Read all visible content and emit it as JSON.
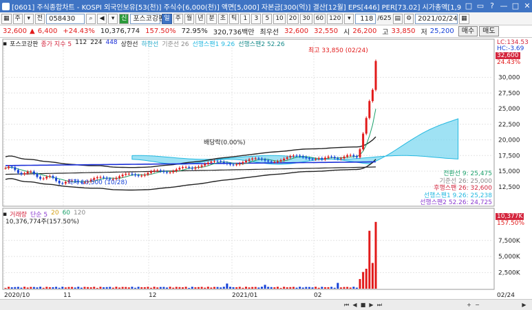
{
  "window": {
    "title": "[0601] 주식종합차트 - KOSPI 외국인보유[53(천)] 주식수[6,000(천)] 액면[5,000] 자본금[300(억)] 결산[12월] EPS[446] PER[73.02] 시가총액[1,956억]",
    "buttons": [
      "□",
      "▭",
      "?",
      "—",
      "□",
      "✕"
    ]
  },
  "toolbar": {
    "market_label": "주",
    "view_label": "전",
    "code": "058430",
    "name": "포스코강판",
    "periods": [
      "일",
      "주",
      "월",
      "년",
      "분",
      "초",
      "틱"
    ],
    "selected_period": "일",
    "minutes": [
      "1",
      "3",
      "5",
      "10",
      "20",
      "30",
      "60",
      "120"
    ],
    "count": "118",
    "count_total": "/625",
    "date": "2021/02/24"
  },
  "info": {
    "price": "32,600",
    "change": "6,400",
    "change_pct": "+24.43%",
    "volume": "10,376,774",
    "volume_pct": "157.50%",
    "ratio": "72.95%",
    "amount": "320,736백만",
    "limit_label": "최우선",
    "ask": "32,600",
    "bid": "32,550",
    "open_label": "시",
    "open": "26,200",
    "high_label": "고",
    "high": "33,850",
    "low_label": "저",
    "low": "25,200",
    "buy": "매수",
    "sell": "매도"
  },
  "price_legend": {
    "name": "포스코강판",
    "items": [
      {
        "label": "종가 지수 5",
        "color": "#d4263e"
      },
      {
        "label": "112",
        "color": "#222222"
      },
      {
        "label": "224",
        "color": "#222222"
      },
      {
        "label": "448",
        "color": "#1b2fd8"
      },
      {
        "label": "상한선",
        "color": "#222222"
      },
      {
        "label": "하한선",
        "color": "#22a9c9"
      },
      {
        "label": "기준선 26",
        "color": "#888888"
      },
      {
        "label": "선행스팬1 9.26",
        "color": "#22b8e0"
      },
      {
        "label": "선행스팬2 52.26",
        "color": "#168a8a"
      }
    ]
  },
  "annotations": {
    "high_note": "최고 33,850 (02/24)",
    "dividend_note": "배당락(0.00%)",
    "low_note": "최저 10,500 (10/28)",
    "lc": "LC:134.53",
    "hc": "HC:-3.69",
    "price_tag": "32,600",
    "pct_tag": "24.43%"
  },
  "indicator_values": [
    {
      "label": "전환선 9: 25,475",
      "color": "#1aa06a"
    },
    {
      "label": "기준선 26: 25,000",
      "color": "#888888"
    },
    {
      "label": "후행스팬 26: 32,600",
      "color": "#d4263e"
    },
    {
      "label": "선행스팬1 9.26: 25,238",
      "color": "#22b8e0"
    },
    {
      "label": "선행스팬2 52.26: 24,725",
      "color": "#8a3ad0"
    }
  ],
  "volume_legend": {
    "items": [
      {
        "label": "거래량",
        "color": "#d4263e"
      },
      {
        "label": "단순 5",
        "color": "#8a3ad0"
      },
      {
        "label": "20",
        "color": "#d4a017"
      },
      {
        "label": "60",
        "color": "#1aa06a"
      },
      {
        "label": "120",
        "color": "#888888"
      }
    ],
    "value": "10,376,774주(157.50%)",
    "vol_tag": "10,377K",
    "vol_pct_tag": "157.50%"
  },
  "chart_data": [
    {
      "type": "candlestick",
      "title": "포스코강판",
      "y_ticks": [
        12500,
        15000,
        17500,
        20000,
        22500,
        25000,
        27500,
        30000
      ],
      "ylim": [
        10500,
        35000
      ],
      "x_labels": [
        "2020/10",
        "11",
        "12",
        "2021/01",
        "02",
        "02/24"
      ],
      "last_close": 32600,
      "high": 33850,
      "low": 10500
    },
    {
      "type": "bar",
      "title": "거래량",
      "y_ticks_labels": [
        "2,500K",
        "5,000K",
        "7,500K"
      ],
      "y_ticks": [
        2500,
        5000,
        7500
      ],
      "ylim": [
        0,
        11000
      ],
      "last_volume_k": 10377
    }
  ]
}
